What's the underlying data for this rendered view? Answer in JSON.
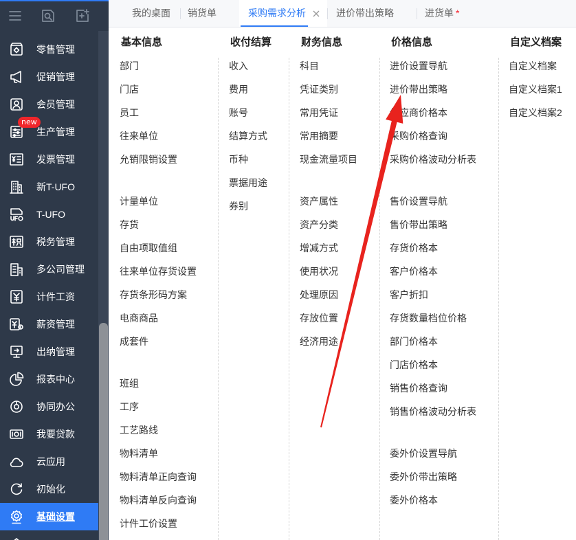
{
  "sidebar": {
    "toolbar": {
      "menu_icon": "hamburger-icon",
      "search_icon": "search-document-icon",
      "add_icon": "add-square-icon"
    },
    "items": [
      {
        "label": "零售管理",
        "icon": "store-icon"
      },
      {
        "label": "促销管理",
        "icon": "megaphone-icon"
      },
      {
        "label": "会员管理",
        "icon": "member-card-icon"
      },
      {
        "label": "生产管理",
        "icon": "production-icon",
        "badge": "new"
      },
      {
        "label": "发票管理",
        "icon": "invoice-icon"
      },
      {
        "label": "新T-UFO",
        "icon": "report-building-icon"
      },
      {
        "label": "T-UFO",
        "icon": "ufo-icon"
      },
      {
        "label": "税务管理",
        "icon": "tax-icon"
      },
      {
        "label": "多公司管理",
        "icon": "multi-company-icon"
      },
      {
        "label": "计件工资",
        "icon": "piecework-icon"
      },
      {
        "label": "薪资管理",
        "icon": "salary-icon"
      },
      {
        "label": "出纳管理",
        "icon": "cashier-icon"
      },
      {
        "label": "报表中心",
        "icon": "pie-chart-icon"
      },
      {
        "label": "协同办公",
        "icon": "collaboration-icon"
      },
      {
        "label": "我要贷款",
        "icon": "loan-icon"
      },
      {
        "label": "云应用",
        "icon": "cloud-icon"
      },
      {
        "label": "初始化",
        "icon": "initialize-icon"
      },
      {
        "label": "基础设置",
        "icon": "settings-icon",
        "active": true
      }
    ]
  },
  "tabs": [
    {
      "label": "我的桌面"
    },
    {
      "label": "销货单"
    },
    {
      "label": "采购需求分析",
      "active": true,
      "close_icon": "close-icon"
    },
    {
      "label": "进价带出策略"
    },
    {
      "label": "进货单",
      "unsaved_mark": "*"
    }
  ],
  "columns": [
    {
      "header": "基本信息",
      "groups": [
        [
          "部门",
          "门店",
          "员工",
          "往来单位",
          "允销限销设置"
        ],
        [
          "计量单位",
          "存货",
          "自由项取值组",
          "往来单位存货设置",
          "存货条形码方案",
          "电商商品",
          "成套件"
        ],
        [
          "班组",
          "工序",
          "工艺路线",
          "物料清单",
          "物料清单正向查询",
          "物料清单反向查询",
          "计件工价设置"
        ]
      ]
    },
    {
      "header": "收付结算",
      "groups": [
        [
          "收入",
          "费用",
          "账号",
          "结算方式",
          "币种",
          "票据用途",
          "券别"
        ]
      ]
    },
    {
      "header": "财务信息",
      "groups": [
        [
          "科目",
          "凭证类别",
          "常用凭证",
          "常用摘要",
          "现金流量项目"
        ],
        [
          "资产属性",
          "资产分类",
          "增减方式",
          "使用状况",
          "处理原因",
          "存放位置",
          "经济用途"
        ]
      ]
    },
    {
      "header": "价格信息",
      "groups": [
        [
          "进价设置导航",
          "进价带出策略",
          "供应商价格本",
          "采购价格查询",
          "采购价格波动分析表"
        ],
        [
          "售价设置导航",
          "售价带出策略",
          "存货价格本",
          "客户价格本",
          "客户折扣",
          "存货数量档位价格",
          "部门价格本",
          "门店价格本",
          "销售价格查询",
          "销售价格波动分析表"
        ],
        [
          "委外价设置导航",
          "委外价带出策略",
          "委外价格本"
        ]
      ]
    },
    {
      "header": "自定义档案",
      "groups": [
        [
          "自定义档案",
          "自定义档案1",
          "自定义档案2"
        ]
      ]
    }
  ],
  "colors": {
    "accent": "#2f7bf5",
    "sidebar_bg": "#2e3949",
    "badge": "#f0262b",
    "unsaved_mark": "#f5222d",
    "annotation_arrow": "#e8231e"
  }
}
